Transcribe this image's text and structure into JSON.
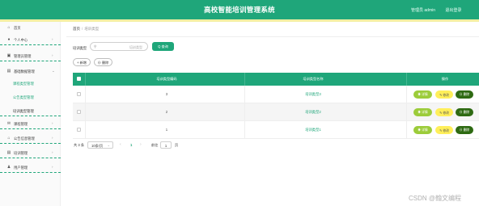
{
  "header": {
    "title": "高校智能培训管理系统",
    "user": "管理员 admin",
    "logout": "退出登录",
    "accent": "#1fa67a"
  },
  "sidebar": {
    "items": [
      {
        "label": "首页",
        "icon": "home-icon",
        "glyph": "⌂"
      },
      {
        "label": "个人中心",
        "icon": "user-icon",
        "glyph": "●",
        "chev": "›"
      },
      {
        "label": "管理员管理",
        "icon": "admin-icon",
        "glyph": "▣",
        "chev": "›"
      },
      {
        "label": "基础数据管理",
        "icon": "data-icon",
        "glyph": "▤",
        "chev": "⌄"
      },
      {
        "label": "课程管理",
        "icon": "course-icon",
        "glyph": "✉",
        "chev": "›"
      },
      {
        "label": "公告信息管理",
        "icon": "notice-icon",
        "glyph": "⌂",
        "chev": "›"
      },
      {
        "label": "培训管理",
        "icon": "training-icon",
        "glyph": "▤",
        "chev": "›"
      },
      {
        "label": "用户管理",
        "icon": "users-icon",
        "glyph": "♟",
        "chev": "›"
      }
    ],
    "sub_items": [
      {
        "label": "课程类型管理"
      },
      {
        "label": "公告类型管理"
      },
      {
        "label": "培训类型管理"
      }
    ]
  },
  "breadcrumb": {
    "home": "首页",
    "sep": "/",
    "current": "培训类型"
  },
  "search": {
    "label": "培训类型",
    "placeholder": "培训类型",
    "button": "Q 查询"
  },
  "actions": {
    "add": "+ 新增",
    "delete": "⊖ 删除"
  },
  "table": {
    "columns": [
      "培训类型编码",
      "培训类型名称",
      "操作"
    ],
    "rows": [
      {
        "code": "3",
        "name": "培训类型3"
      },
      {
        "code": "2",
        "name": "培训类型2"
      },
      {
        "code": "1",
        "name": "培训类型1"
      }
    ],
    "row_actions": {
      "detail": "◉ 详情",
      "edit": "✎ 修改",
      "delete": "⊖ 删除"
    }
  },
  "pagination": {
    "total": "共 3 条",
    "page_size": "10条/页",
    "current_page": "1",
    "goto_label": "前往",
    "goto_value": "1",
    "page_suffix": "页"
  },
  "watermark": "CSDN @翰文编程"
}
